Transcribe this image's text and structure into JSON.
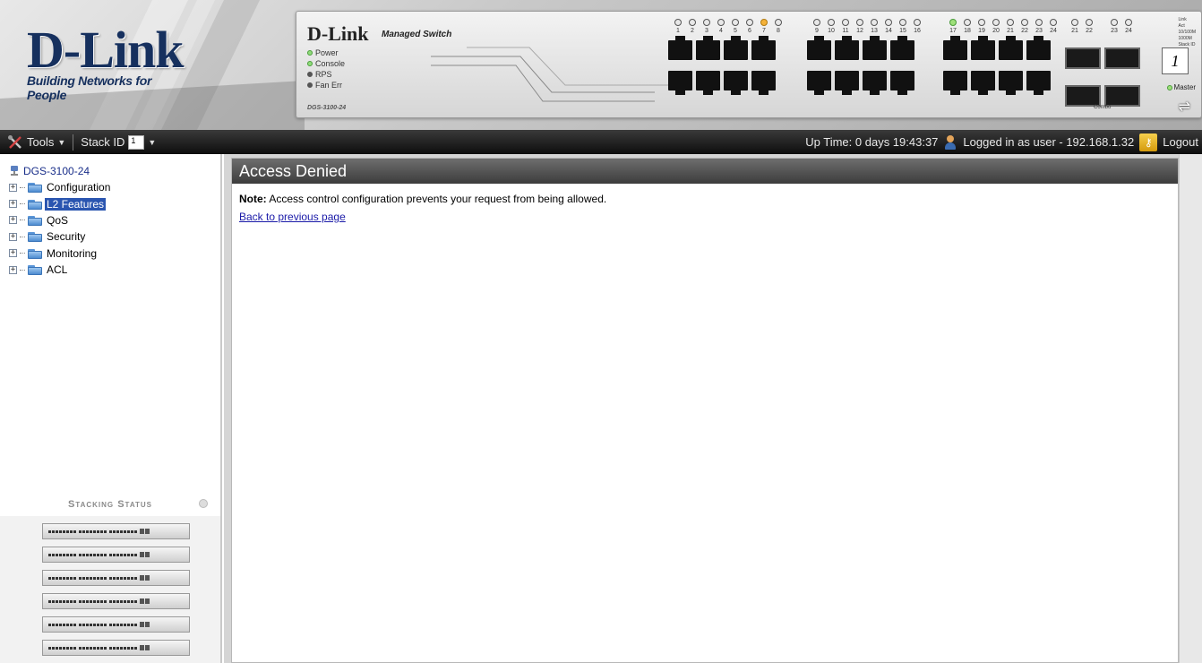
{
  "banner": {
    "logo_main": "D-Link",
    "logo_tagline": "Building Networks for People",
    "switch_brand": "D-Link",
    "switch_model_tag": "Managed Switch",
    "switch_model_no": "DGS-3100-24",
    "leds": [
      "Power",
      "Console",
      "RPS",
      "Fan Err"
    ],
    "port_groups": [
      {
        "labels": [
          "1",
          "2",
          "3",
          "4",
          "5",
          "6",
          "7",
          "8"
        ]
      },
      {
        "labels": [
          "9",
          "10",
          "11",
          "12",
          "13",
          "14",
          "15",
          "16"
        ]
      },
      {
        "labels": [
          "17",
          "18",
          "19",
          "20",
          "21",
          "22",
          "23",
          "24"
        ]
      }
    ],
    "combo_ports_a": [
      "21",
      "22"
    ],
    "combo_ports_b": [
      "23",
      "24"
    ],
    "combo_label": "Combo",
    "master_label": "Master",
    "legend": [
      "Link",
      "Act",
      "10/100M",
      "1000M",
      "Stack ID"
    ],
    "colors": {
      "logo": "#16305e",
      "amber": "#f4b23a",
      "green": "#9ee07a"
    }
  },
  "toolbar": {
    "tools_label": "Tools",
    "stack_id_label": "Stack ID",
    "stack_id_value": "1",
    "uptime": "Up Time: 0 days 19:43:37",
    "logged_in": "Logged in as user - 192.168.1.32",
    "logout_label": "Logout"
  },
  "sidebar": {
    "root": "DGS-3100-24",
    "items": [
      {
        "label": "Configuration",
        "icon": "folder-icon"
      },
      {
        "label": "L2 Features",
        "icon": "folder-icon",
        "selected": true
      },
      {
        "label": "QoS",
        "icon": "folder-icon"
      },
      {
        "label": "Security",
        "icon": "folder-icon"
      },
      {
        "label": "Monitoring",
        "icon": "folder-icon"
      },
      {
        "label": "ACL",
        "icon": "folder-icon"
      }
    ],
    "stacking_status_title": "Stacking Status",
    "stack_units_count_display": 6
  },
  "main": {
    "title": "Access Denied",
    "note_prefix": "Note:",
    "note_text": "Access control configuration prevents your request from being allowed.",
    "back_link": "Back to previous page"
  }
}
